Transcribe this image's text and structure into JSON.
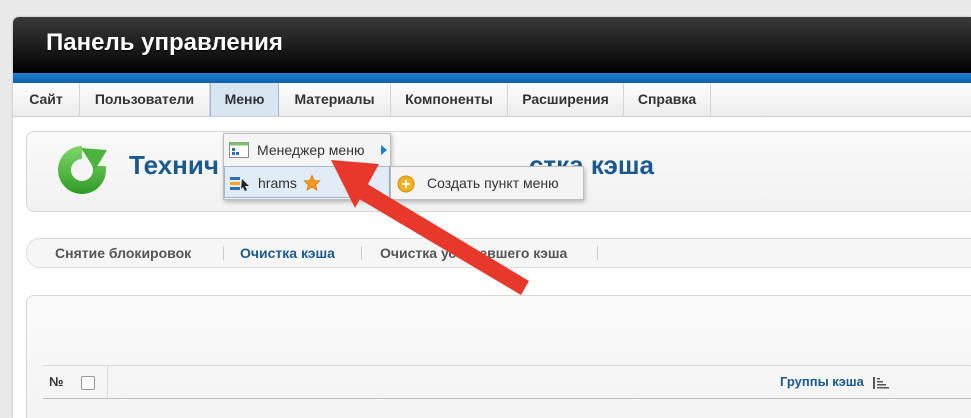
{
  "header": {
    "title": "Панель управления"
  },
  "nav": {
    "items": [
      {
        "label": "Сайт"
      },
      {
        "label": "Пользователи"
      },
      {
        "label": "Меню"
      },
      {
        "label": "Материалы"
      },
      {
        "label": "Компоненты"
      },
      {
        "label": "Расширения"
      },
      {
        "label": "Справка"
      }
    ],
    "active": "Меню"
  },
  "dropdown": {
    "items": [
      {
        "label": "Менеджер меню",
        "icon": "menu-manager-icon",
        "has_submenu": true
      },
      {
        "label": "hrams",
        "icon": "menu-icon",
        "badge": "star-icon"
      }
    ]
  },
  "submenu": {
    "items": [
      {
        "label": "Создать пункт меню",
        "icon": "add-icon"
      }
    ]
  },
  "page": {
    "title_left": "Технич",
    "title_right": "стка кэша"
  },
  "subtabs": {
    "items": [
      {
        "label": "Снятие блокировок"
      },
      {
        "label": "Очистка кэша"
      },
      {
        "label": "Очистка устаревшего кэша"
      }
    ],
    "active": "Очистка кэша"
  },
  "table": {
    "columns": {
      "number": "№",
      "groups": "Группы кэша"
    }
  },
  "colors": {
    "header_bg": "#121212",
    "accent_blue": "#0d5fab",
    "title_blue": "#1a5a8e",
    "arrow_red": "#e8382b",
    "refresh_green": "#4bb43c"
  }
}
